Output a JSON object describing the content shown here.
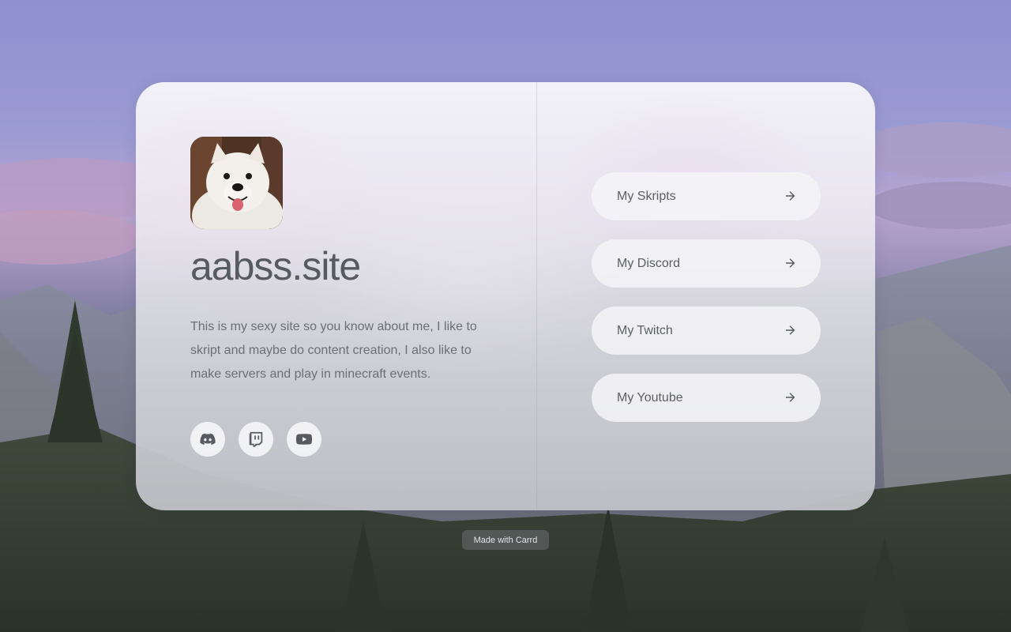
{
  "profile": {
    "title": "aabss.site",
    "bio": "This is my sexy site so you know about me, I like to skript and maybe do content creation, I also like to make servers and play in minecraft events.",
    "avatar_icon": "samoyed-dog-avatar"
  },
  "social": [
    {
      "icon": "discord-icon"
    },
    {
      "icon": "twitch-icon"
    },
    {
      "icon": "youtube-icon"
    }
  ],
  "links": [
    {
      "label": "My Skripts",
      "icon": "arrow-right-icon"
    },
    {
      "label": "My Discord",
      "icon": "arrow-right-icon"
    },
    {
      "label": "My Twitch",
      "icon": "arrow-right-icon"
    },
    {
      "label": "My Youtube",
      "icon": "arrow-right-icon"
    }
  ],
  "footer": {
    "badge": "Made with Carrd"
  },
  "colors": {
    "text_primary": "#575b61",
    "text_secondary": "#6c6f75",
    "sky": "#8d8fc9"
  }
}
